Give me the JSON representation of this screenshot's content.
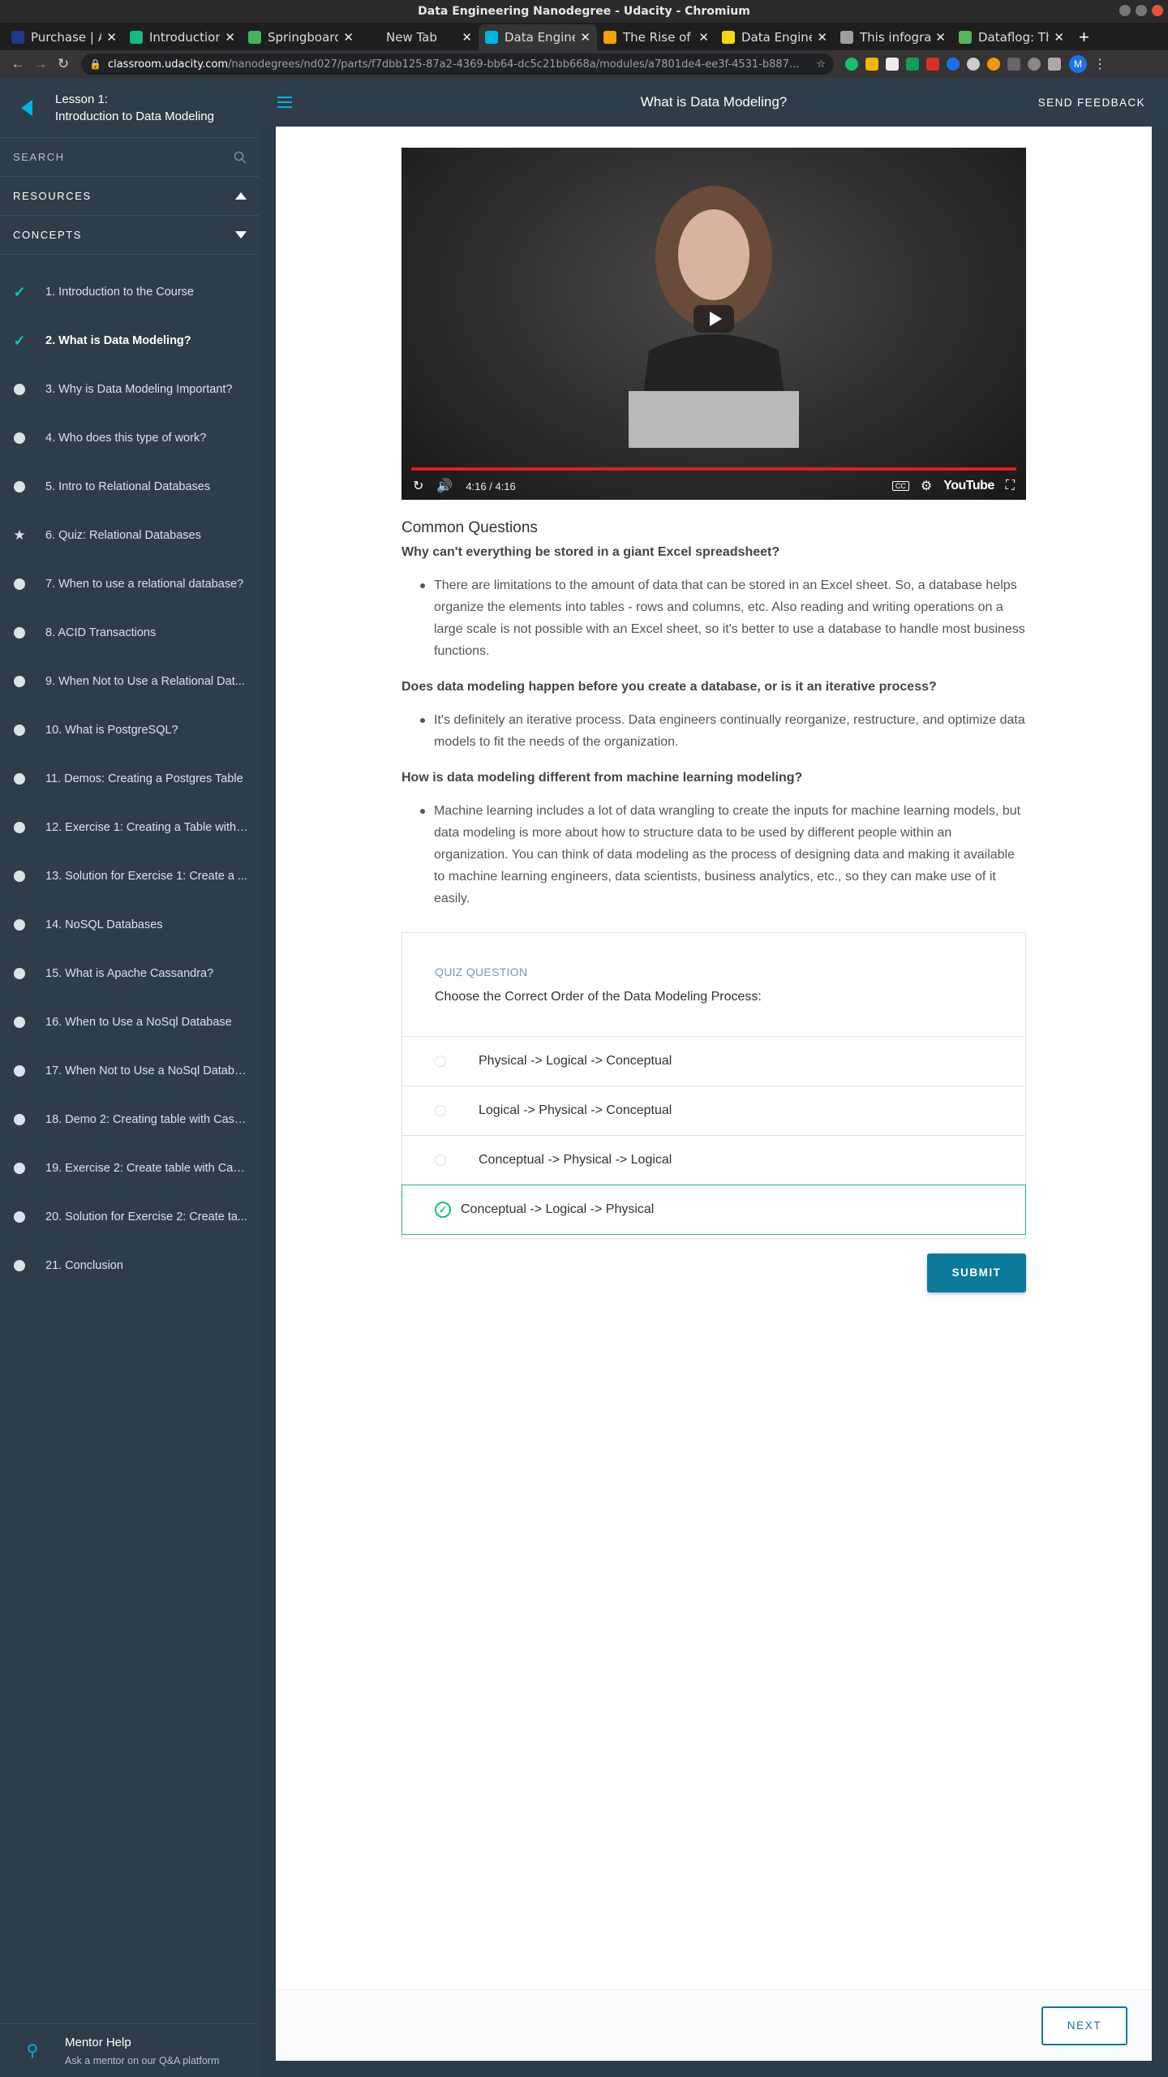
{
  "window": {
    "title": "Data Engineering Nanodegree - Udacity - Chromium"
  },
  "tabs": [
    {
      "label": "Purchase | A",
      "color": "#1f3a8a",
      "active": false
    },
    {
      "label": "Introduction",
      "color": "#18b884",
      "active": false
    },
    {
      "label": "Springboard",
      "color": "#45b35a",
      "active": false
    },
    {
      "label": "New Tab",
      "color": "#1e1e1e",
      "active": false
    },
    {
      "label": "Data Engine",
      "color": "#02b3e4",
      "active": true
    },
    {
      "label": "The Rise of D",
      "color": "#f2a300",
      "active": false
    },
    {
      "label": "Data Engine",
      "color": "#f5d90a",
      "active": false
    },
    {
      "label": "This infogra",
      "color": "#9e9e9e",
      "active": false
    },
    {
      "label": "Dataflog: Th",
      "color": "#53b65c",
      "active": false
    }
  ],
  "address": {
    "host": "classroom.udacity.com",
    "path": "/nanodegrees/nd027/parts/f7dbb125-87a2-4369-bb64-dc5c21bb668a/modules/a7801de4-ee3f-4531-b887..."
  },
  "profile_initial": "M",
  "header": {
    "lesson_line1": "Lesson 1:",
    "lesson_line2": "Introduction to Data Modeling",
    "page_title": "What is Data Modeling?",
    "feedback": "SEND FEEDBACK"
  },
  "sidebar": {
    "search": "SEARCH",
    "resources": "RESOURCES",
    "concepts": "CONCEPTS",
    "items": [
      {
        "label": "1. Introduction to the Course",
        "status": "check"
      },
      {
        "label": "2. What is Data Modeling?",
        "status": "check"
      },
      {
        "label": "3. Why is Data Modeling Important?",
        "status": "dot"
      },
      {
        "label": "4. Who does this type of work?",
        "status": "dot"
      },
      {
        "label": "5. Intro to Relational Databases",
        "status": "dot"
      },
      {
        "label": "6. Quiz: Relational Databases",
        "status": "star"
      },
      {
        "label": "7. When to use a relational database?",
        "status": "dot"
      },
      {
        "label": "8. ACID Transactions",
        "status": "dot"
      },
      {
        "label": "9. When Not to Use a Relational Dat...",
        "status": "dot"
      },
      {
        "label": "10. What is PostgreSQL?",
        "status": "dot"
      },
      {
        "label": "11. Demos: Creating a Postgres Table",
        "status": "dot"
      },
      {
        "label": "12. Exercise 1: Creating a Table with ...",
        "status": "dot"
      },
      {
        "label": "13. Solution for Exercise 1: Create a ...",
        "status": "dot"
      },
      {
        "label": "14. NoSQL Databases",
        "status": "dot"
      },
      {
        "label": "15. What is Apache Cassandra?",
        "status": "dot"
      },
      {
        "label": "16. When to Use a NoSql Database",
        "status": "dot"
      },
      {
        "label": "17. When Not to Use a NoSql Databa...",
        "status": "dot"
      },
      {
        "label": "18. Demo 2: Creating table with Cass...",
        "status": "dot"
      },
      {
        "label": "19. Exercise 2: Create table with Cas...",
        "status": "dot"
      },
      {
        "label": "20. Solution for Exercise 2: Create ta...",
        "status": "dot"
      },
      {
        "label": "21. Conclusion",
        "status": "dot"
      }
    ],
    "current_index": 1,
    "mentor_title": "Mentor Help",
    "mentor_sub": "Ask a mentor on our Q&A platform"
  },
  "video": {
    "time": "4:16 / 4:16",
    "progress": 1.0,
    "logo": "YouTube"
  },
  "content": {
    "heading": "Common Questions",
    "qa": [
      {
        "q": "Why can't everything be stored in a giant Excel spreadsheet?",
        "a": "There are limitations to the amount of data that can be stored in an Excel sheet. So, a database helps organize the elements into tables - rows and columns, etc. Also reading and writing operations on a large scale is not possible with an Excel sheet, so it's better to use a database to handle most business functions."
      },
      {
        "q": "Does data modeling happen before you create a database, or is it an iterative process?",
        "a": "It's definitely an iterative process. Data engineers continually reorganize, restructure, and optimize data models to fit the needs of the organization."
      },
      {
        "q": "How is data modeling different from machine learning modeling?",
        "a": "Machine learning includes a lot of data wrangling to create the inputs for machine learning models, but data modeling is more about how to structure data to be used by different people within an organization. You can think of data modeling as the process of designing data and making it available to machine learning engineers, data scientists, business analytics, etc., so they can make use of it easily."
      }
    ]
  },
  "quiz": {
    "label": "QUIZ QUESTION",
    "question": "Choose the Correct Order of the Data Modeling Process:",
    "options": [
      "Physical -> Logical -> Conceptual",
      "Logical -> Physical -> Conceptual",
      "Conceptual -> Physical -> Logical",
      "Conceptual -> Logical -> Physical"
    ],
    "selected_index": 3,
    "submit": "SUBMIT"
  },
  "footer": {
    "next": "NEXT"
  }
}
